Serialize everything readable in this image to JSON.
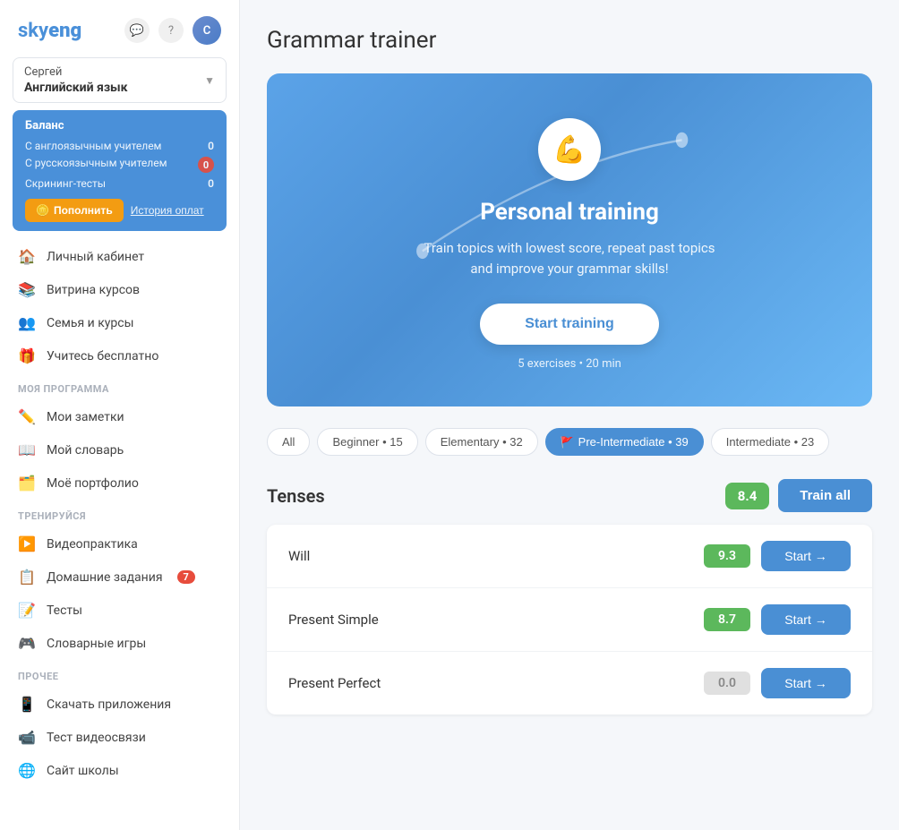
{
  "app": {
    "logo_sky": "sky",
    "logo_eng": "eng"
  },
  "sidebar": {
    "user": {
      "name": "Сергей",
      "course": "Английский язык"
    },
    "balance": {
      "title": "Баланс",
      "rows": [
        {
          "label": "С англоязычным учителем",
          "value": "0",
          "badge": false
        },
        {
          "label": "С русскоязычным учителем",
          "value": "0",
          "badge": true
        },
        {
          "label": "Скрининг-тесты",
          "value": "0",
          "badge": false
        }
      ],
      "btn_replenish": "Пополнить",
      "btn_history": "История оплат"
    },
    "main_nav": [
      {
        "id": "cabinet",
        "label": "Личный кабинет",
        "icon": "🏠"
      },
      {
        "id": "courses",
        "label": "Витрина курсов",
        "icon": "📚"
      },
      {
        "id": "family",
        "label": "Семья и курсы",
        "icon": "👥"
      },
      {
        "id": "free",
        "label": "Учитесь бесплатно",
        "icon": "🎁"
      }
    ],
    "my_program_label": "МОЯ ПРОГРАММА",
    "my_program_nav": [
      {
        "id": "notes",
        "label": "Мои заметки",
        "icon": "✏️"
      },
      {
        "id": "dictionary",
        "label": "Мой словарь",
        "icon": "📖"
      },
      {
        "id": "portfolio",
        "label": "Моё портфолио",
        "icon": "🗂️"
      }
    ],
    "train_label": "ТРЕНИРУЙСЯ",
    "train_nav": [
      {
        "id": "videopractice",
        "label": "Видеопрактика",
        "icon": "▶️"
      },
      {
        "id": "homework",
        "label": "Домашние задания",
        "icon": "📋",
        "badge": "7"
      },
      {
        "id": "tests",
        "label": "Тесты",
        "icon": "📝"
      },
      {
        "id": "wordgames",
        "label": "Словарные игры",
        "icon": "🎮"
      }
    ],
    "other_label": "ПРОЧЕЕ",
    "other_nav": [
      {
        "id": "apps",
        "label": "Скачать приложения",
        "icon": "📱"
      },
      {
        "id": "video",
        "label": "Тест видеосвязи",
        "icon": "📹"
      },
      {
        "id": "school",
        "label": "Сайт школы",
        "icon": "🌐"
      }
    ]
  },
  "main": {
    "page_title": "Grammar trainer",
    "hero": {
      "emoji": "💪",
      "title": "Personal training",
      "subtitle_line1": "Train topics with lowest score, repeat past topics",
      "subtitle_line2": "and improve your grammar skills!",
      "btn_start": "Start training",
      "meta": "5 exercises • 20 min"
    },
    "filters": [
      {
        "id": "all",
        "label": "All",
        "active": false
      },
      {
        "id": "beginner",
        "label": "Beginner • 15",
        "active": false
      },
      {
        "id": "elementary",
        "label": "Elementary • 32",
        "active": false
      },
      {
        "id": "pre_intermediate",
        "label": "Pre-Intermediate • 39",
        "active": true,
        "flag": "🚩"
      },
      {
        "id": "intermediate",
        "label": "Intermediate • 23",
        "active": false
      }
    ],
    "section": {
      "title": "Tenses",
      "score": "8.4",
      "btn_train_all": "Train all",
      "topics": [
        {
          "name": "Will",
          "score": "9.3",
          "score_type": "green",
          "btn": "Start →"
        },
        {
          "name": "Present Simple",
          "score": "8.7",
          "score_type": "green",
          "btn": "Start →"
        },
        {
          "name": "Present Perfect",
          "score": "0.0",
          "score_type": "gray",
          "btn": "Start →"
        }
      ]
    }
  }
}
